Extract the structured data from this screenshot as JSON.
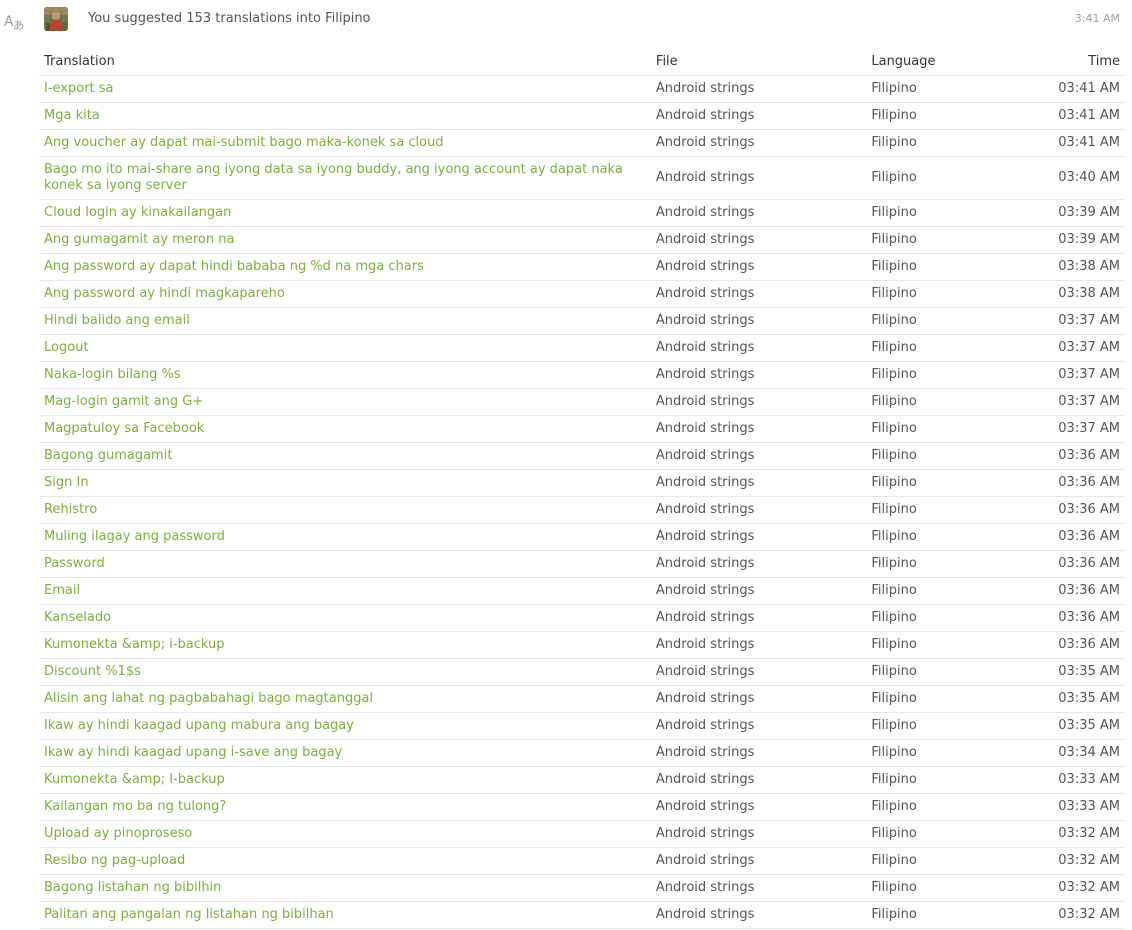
{
  "header": {
    "summary": "You suggested 153 translations into Filipino",
    "time": "3:41 AM",
    "icon": "translate-icon",
    "avatar": "user-avatar"
  },
  "table": {
    "columns": {
      "translation": "Translation",
      "file": "File",
      "language": "Language",
      "time": "Time"
    },
    "rows": [
      {
        "translation": "I-export sa",
        "file": "Android strings",
        "language": "Filipino",
        "time": "03:41 AM"
      },
      {
        "translation": "Mga kita",
        "file": "Android strings",
        "language": "Filipino",
        "time": "03:41 AM"
      },
      {
        "translation": "Ang voucher ay dapat mai-submit bago maka-konek sa cloud",
        "file": "Android strings",
        "language": "Filipino",
        "time": "03:41 AM"
      },
      {
        "translation": "Bago mo ito mai-share ang iyong data sa iyong buddy, ang iyong account ay dapat naka konek sa iyong server",
        "file": "Android strings",
        "language": "Filipino",
        "time": "03:40 AM"
      },
      {
        "translation": "Cloud login ay kinakailangan",
        "file": "Android strings",
        "language": "Filipino",
        "time": "03:39 AM"
      },
      {
        "translation": "Ang gumagamit ay meron na",
        "file": "Android strings",
        "language": "Filipino",
        "time": "03:39 AM"
      },
      {
        "translation": "Ang password ay dapat hindi bababa ng %d na mga chars",
        "file": "Android strings",
        "language": "Filipino",
        "time": "03:38 AM"
      },
      {
        "translation": "Ang password ay hindi magkapareho",
        "file": "Android strings",
        "language": "Filipino",
        "time": "03:38 AM"
      },
      {
        "translation": "Hindi balido ang email",
        "file": "Android strings",
        "language": "Filipino",
        "time": "03:37 AM"
      },
      {
        "translation": "Logout",
        "file": "Android strings",
        "language": "Filipino",
        "time": "03:37 AM"
      },
      {
        "translation": "Naka-login bilang %s",
        "file": "Android strings",
        "language": "Filipino",
        "time": "03:37 AM"
      },
      {
        "translation": "Mag-login gamit ang G+",
        "file": "Android strings",
        "language": "Filipino",
        "time": "03:37 AM"
      },
      {
        "translation": "Magpatuloy sa Facebook",
        "file": "Android strings",
        "language": "Filipino",
        "time": "03:37 AM"
      },
      {
        "translation": "Bagong gumagamit",
        "file": "Android strings",
        "language": "Filipino",
        "time": "03:36 AM"
      },
      {
        "translation": "Sign In",
        "file": "Android strings",
        "language": "Filipino",
        "time": "03:36 AM"
      },
      {
        "translation": "Rehistro",
        "file": "Android strings",
        "language": "Filipino",
        "time": "03:36 AM"
      },
      {
        "translation": "Muling ilagay ang password",
        "file": "Android strings",
        "language": "Filipino",
        "time": "03:36 AM"
      },
      {
        "translation": "Password",
        "file": "Android strings",
        "language": "Filipino",
        "time": "03:36 AM"
      },
      {
        "translation": "Email",
        "file": "Android strings",
        "language": "Filipino",
        "time": "03:36 AM"
      },
      {
        "translation": "Kanselado",
        "file": "Android strings",
        "language": "Filipino",
        "time": "03:36 AM"
      },
      {
        "translation": "Kumonekta &amp; i-backup",
        "file": "Android strings",
        "language": "Filipino",
        "time": "03:36 AM"
      },
      {
        "translation": "Discount %1$s",
        "file": "Android strings",
        "language": "Filipino",
        "time": "03:35 AM"
      },
      {
        "translation": "Alisin ang lahat ng pagbabahagi bago magtanggal",
        "file": "Android strings",
        "language": "Filipino",
        "time": "03:35 AM"
      },
      {
        "translation": "Ikaw ay hindi kaagad upang mabura ang bagay",
        "file": "Android strings",
        "language": "Filipino",
        "time": "03:35 AM"
      },
      {
        "translation": "Ikaw ay hindi kaagad upang i-save ang bagay",
        "file": "Android strings",
        "language": "Filipino",
        "time": "03:34 AM"
      },
      {
        "translation": "Kumonekta &amp; I-backup",
        "file": "Android strings",
        "language": "Filipino",
        "time": "03:33 AM"
      },
      {
        "translation": "Kailangan mo ba ng tulong?",
        "file": "Android strings",
        "language": "Filipino",
        "time": "03:33 AM"
      },
      {
        "translation": "Upload ay pinoproseso",
        "file": "Android strings",
        "language": "Filipino",
        "time": "03:32 AM"
      },
      {
        "translation": "Resibo ng pag-upload",
        "file": "Android strings",
        "language": "Filipino",
        "time": "03:32 AM"
      },
      {
        "translation": "Bagong listahan ng bibilhin",
        "file": "Android strings",
        "language": "Filipino",
        "time": "03:32 AM"
      },
      {
        "translation": "Palitan ang pangalan ng listahan ng bibilhan",
        "file": "Android strings",
        "language": "Filipino",
        "time": "03:32 AM"
      }
    ]
  },
  "colors": {
    "link": "#7fae3f",
    "border": "#e7e7e7",
    "muted": "#a0a0a0"
  }
}
